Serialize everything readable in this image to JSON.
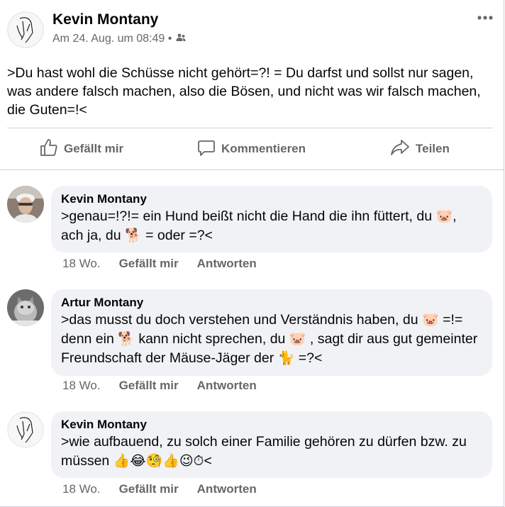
{
  "post": {
    "author": "Kevin Montany",
    "meta": "Am 24. Aug. um 08:49 •",
    "text": ">Du hast wohl die Schüsse nicht gehört=?! = Du darfst und sollst nur sagen, was andere falsch machen, also die Bösen, und nicht was wir falsch machen, die Guten=!<",
    "audience_icon": "friends-icon",
    "more_icon": "more-options-icon"
  },
  "actions": {
    "like": "Gefällt mir",
    "comment": "Kommentieren",
    "share": "Teilen"
  },
  "comments": [
    {
      "author": "Kevin Montany",
      "parts": [
        ">genau=!?!= ein Hund beißt nicht die Hand die ihn füttert, du ",
        "🐷",
        ", ach ja, du ",
        "🐕",
        " = oder =?<"
      ],
      "time": "18 Wo.",
      "like": "Gefällt mir",
      "reply": "Antworten"
    },
    {
      "author": "Artur Montany",
      "parts": [
        ">das musst du doch verstehen und Verständnis haben, du ",
        "🐷",
        " =!= denn ein ",
        "🐕",
        " kann nicht sprechen, du ",
        "🐷",
        " , sagt dir aus gut gemeinter Freundschaft der Mäuse-Jäger der  ",
        "🐈",
        " =?<"
      ],
      "time": "18 Wo.",
      "like": "Gefällt mir",
      "reply": "Antworten"
    },
    {
      "author": "Kevin Montany",
      "parts": [
        ">wie aufbauend, zu solch einer Familie gehören zu dürfen bzw. zu müssen ",
        "👍😂🧐👍😉⏱",
        "<"
      ],
      "time": "18 Wo.",
      "like": "Gefällt mir",
      "reply": "Antworten"
    }
  ]
}
